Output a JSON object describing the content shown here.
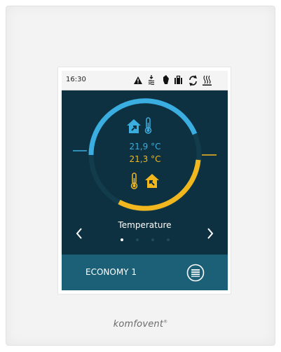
{
  "device": {
    "brand": "komfovent",
    "brand_mark": "®"
  },
  "statusbar": {
    "time": "16:30",
    "icons": [
      "warning-icon",
      "fan-heat-icon",
      "hand-override-icon",
      "briefcase-icon",
      "refresh-icon",
      "heater-icon"
    ]
  },
  "gauge": {
    "actual_temperature": "21,9 °C",
    "set_temperature": "21,3 °C",
    "actual_icon": "house-exhaust-icon",
    "set_icon": "house-supply-icon"
  },
  "screen": {
    "title": "Temperature",
    "page_count": 4,
    "active_page": 0
  },
  "footer": {
    "mode": "ECONOMY 1"
  },
  "colors": {
    "screen_bg": "#0d3140",
    "actual": "#3aaee0",
    "setpoint": "#f2b71f",
    "footer_bg": "#1c6078"
  }
}
